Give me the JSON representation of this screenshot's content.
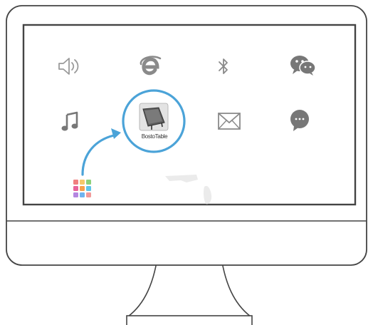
{
  "desktop": {
    "icons": [
      {
        "name": "speaker-icon",
        "label": ""
      },
      {
        "name": "internet-explorer-icon",
        "label": ""
      },
      {
        "name": "bluetooth-icon",
        "label": ""
      },
      {
        "name": "wechat-icon",
        "label": ""
      },
      {
        "name": "music-note-icon",
        "label": ""
      },
      {
        "name": "bostotable-app-icon",
        "label": "BostoTable"
      },
      {
        "name": "mail-icon",
        "label": ""
      },
      {
        "name": "chat-bubble-icon",
        "label": ""
      },
      {
        "name": "app-grid-icon",
        "label": ""
      }
    ],
    "highlight_color": "#4ba3d8",
    "app_grid_colors": [
      "#f07f7f",
      "#f5c86a",
      "#8dd17a",
      "#e8639a",
      "#f6a04d",
      "#5ec4e8",
      "#b486e0",
      "#6fb4f0",
      "#f19a9a"
    ]
  }
}
